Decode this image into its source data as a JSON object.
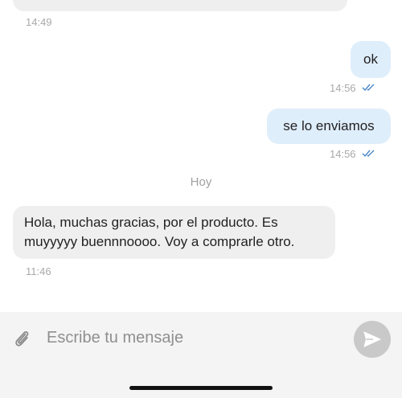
{
  "messages": [
    {
      "direction": "in",
      "text": "",
      "time": "14:49"
    },
    {
      "direction": "out",
      "text": "ok",
      "time": "14:56",
      "status_icon": "double-check-icon"
    },
    {
      "direction": "out",
      "text": "se lo enviamos",
      "time": "14:56",
      "status_icon": "double-check-icon"
    }
  ],
  "day_separator": "Hoy",
  "latest_message": {
    "direction": "in",
    "line1": "Hola, muchas gracias, por el producto. Es",
    "line2": "muyyyyy buennnoooo. Voy a comprarle otro.",
    "time": "11:46"
  },
  "composer": {
    "attach_icon": "paperclip-icon",
    "placeholder": "Escribe tu mensaje",
    "value": "",
    "send_icon": "send-icon"
  },
  "colors": {
    "incoming_bubble": "#efefef",
    "outgoing_bubble": "#dfeefb",
    "read_ticks": "#4a86c5",
    "timestamp": "#a9a9a9",
    "send_button": "#c9c9c9",
    "composer_bg": "#f4f4f4"
  }
}
